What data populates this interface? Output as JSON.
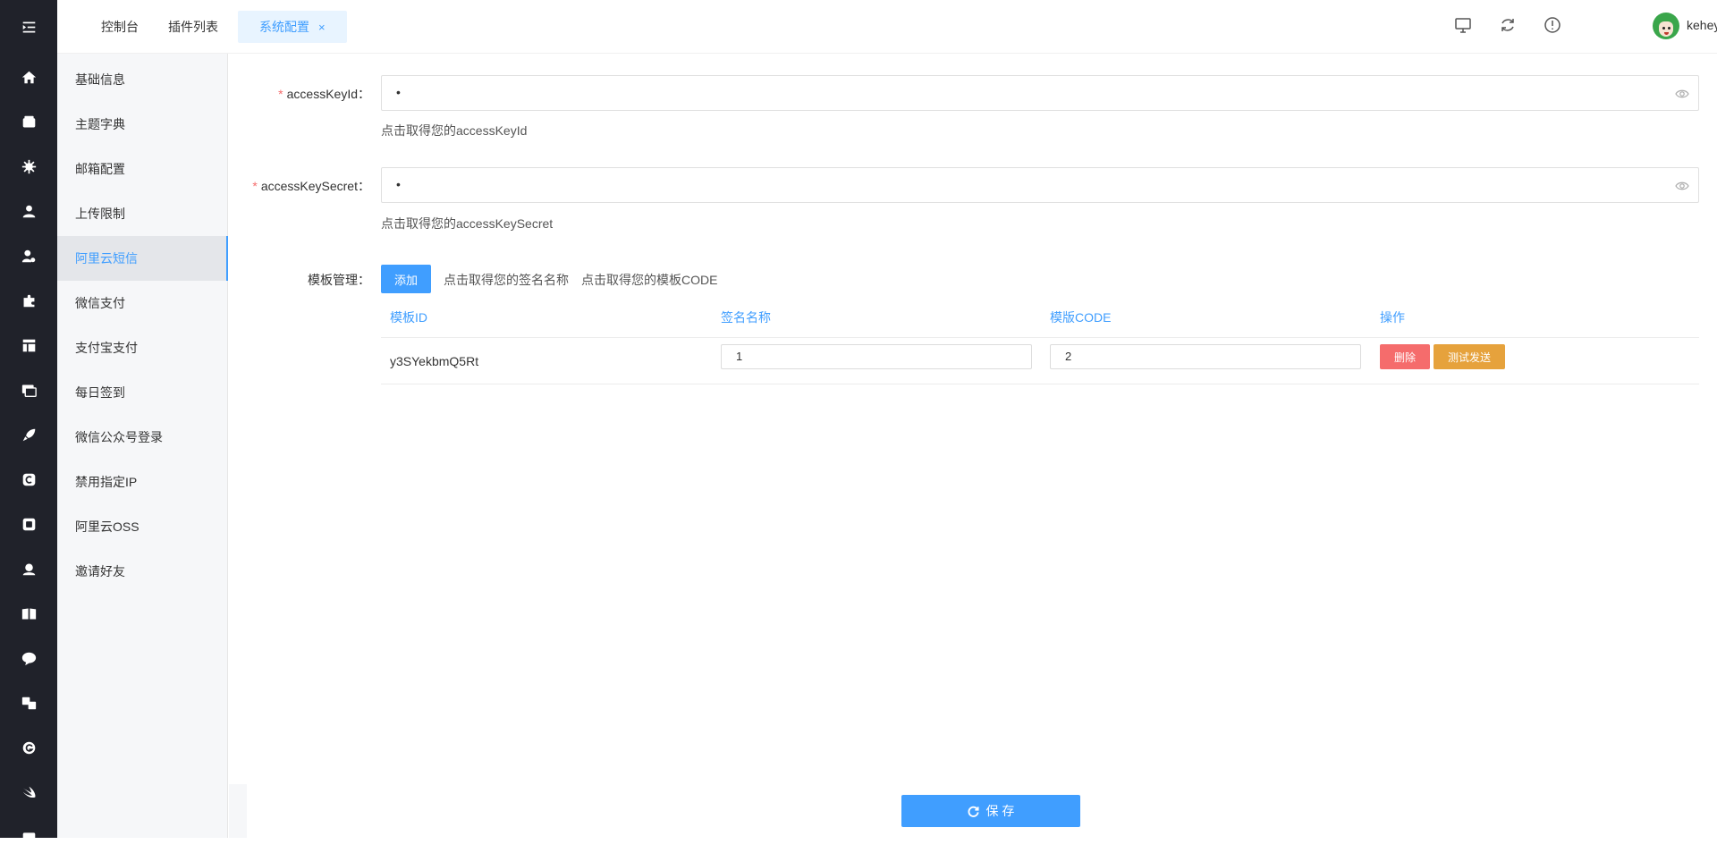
{
  "header": {
    "tabs": [
      {
        "label": "控制台"
      },
      {
        "label": "插件列表"
      },
      {
        "label": "系统配置",
        "close": "×"
      }
    ],
    "icons": [
      "monitor-icon",
      "refresh-icon",
      "info-icon"
    ],
    "username": "keheying"
  },
  "rail": {
    "icons": [
      "menu-fold-icon",
      "home-icon",
      "wallet-icon",
      "gear-icon",
      "user-icon",
      "user-settings-icon",
      "puzzle-icon",
      "layout-icon",
      "image-icon",
      "rocket-icon",
      "c-logo-icon",
      "square-logo-icon",
      "customer-service-icon",
      "book-icon",
      "chat-icon",
      "translate-icon",
      "g-logo-icon",
      "swift-icon",
      "more-icon"
    ]
  },
  "submenu": {
    "items": [
      {
        "label": "基础信息"
      },
      {
        "label": "主题字典"
      },
      {
        "label": "邮箱配置"
      },
      {
        "label": "上传限制"
      },
      {
        "label": "阿里云短信"
      },
      {
        "label": "微信支付"
      },
      {
        "label": "支付宝支付"
      },
      {
        "label": "每日签到"
      },
      {
        "label": "微信公众号登录"
      },
      {
        "label": "禁用指定IP"
      },
      {
        "label": "阿里云OSS"
      },
      {
        "label": "邀请好友"
      }
    ],
    "active": "阿里云短信"
  },
  "form": {
    "access_key_id": {
      "required": "*",
      "label": "accessKeyId：",
      "value": "•",
      "hint": "点击取得您的accessKeyId"
    },
    "access_key_secret": {
      "required": "*",
      "label": "accessKeySecret：",
      "value": "•",
      "hint": "点击取得您的accessKeySecret"
    },
    "template": {
      "label": "模板管理：",
      "add_label": "添加",
      "sign_hint": "点击取得您的签名名称",
      "code_hint": "点击取得您的模板CODE"
    }
  },
  "table": {
    "headers": [
      "模板ID",
      "签名名称",
      "模版CODE",
      "操作"
    ],
    "rows": [
      {
        "id": "y3SYekbmQ5Rt",
        "sign": "1",
        "code": "2",
        "delete_label": "删除",
        "test_label": "测试发送"
      }
    ]
  },
  "save_label": "保 存",
  "colors": {
    "accent": "#409eff",
    "danger": "#f56c6c",
    "warning": "#e6a23c",
    "rail": "#20222a"
  }
}
